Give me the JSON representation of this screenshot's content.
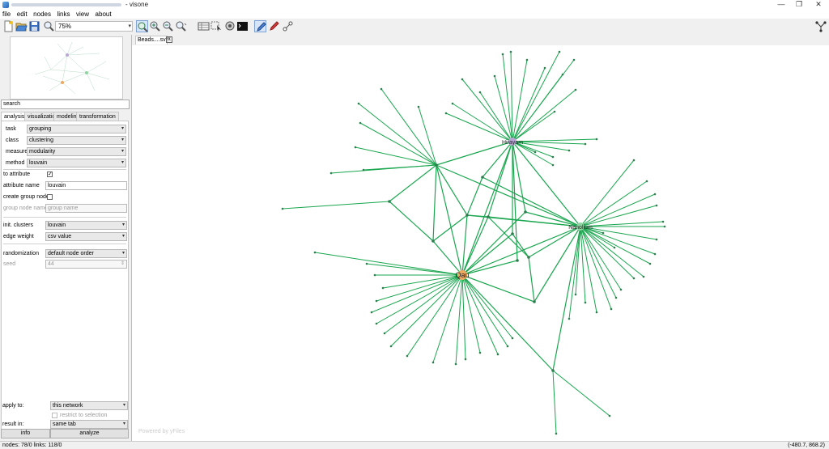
{
  "window": {
    "title": "- visone",
    "minimize": "—",
    "maximize": "❐",
    "close": "✕"
  },
  "menu": [
    "file",
    "edit",
    "nodes",
    "links",
    "view",
    "about"
  ],
  "toolbar": {
    "zoom_value": "75%"
  },
  "search": {
    "placeholder": "search"
  },
  "tabs": [
    "analysis",
    "visualization",
    "modeling",
    "transformation"
  ],
  "analysis": {
    "task_label": "task",
    "task_value": "grouping",
    "class_label": "class",
    "class_value": "clustering",
    "measure_label": "measure",
    "measure_value": "modularity",
    "method_label": "method",
    "method_value": "louvain",
    "to_attribute_label": "to attribute",
    "to_attribute_checked": "✓",
    "attribute_name_label": "attribute name",
    "attribute_name_value": "louvain",
    "create_group_nodes_label": "create group nodes",
    "group_node_name_label": "group node name",
    "group_node_name_value": "group name",
    "init_clusters_label": "init. clusters",
    "init_clusters_value": "louvain",
    "edge_weight_label": "edge weight",
    "edge_weight_value": "csv value",
    "randomization_label": "randomization",
    "randomization_value": "default node order",
    "seed_label": "seed",
    "seed_value": "44"
  },
  "footer": {
    "apply_to_label": "apply to:",
    "apply_to_value": "this network",
    "restrict_label": "restrict to selection",
    "result_in_label": "result in:",
    "result_in_value": "same tab",
    "info_button": "info",
    "analyze_button": "analyze"
  },
  "graph_tab": {
    "label": "Beads....sv*",
    "close": "x"
  },
  "canvas": {
    "powered_by": "Powered by yFiles"
  },
  "status": {
    "counts": "nodes: 78/0  links: 118/0",
    "coords": "(-480.7, 868.2)"
  },
  "graph": {
    "edge_color": "#1aa64f",
    "node_color": "#2e7d4f",
    "hubs": [
      {
        "id": "hub-north",
        "label": "Hirayam",
        "color": "#b9a6d6"
      },
      {
        "id": "hub-east",
        "label": "Nanolium",
        "color": "#8fd3a1"
      },
      {
        "id": "hub-south",
        "label": "Qau",
        "color": "#f0a860"
      }
    ]
  }
}
